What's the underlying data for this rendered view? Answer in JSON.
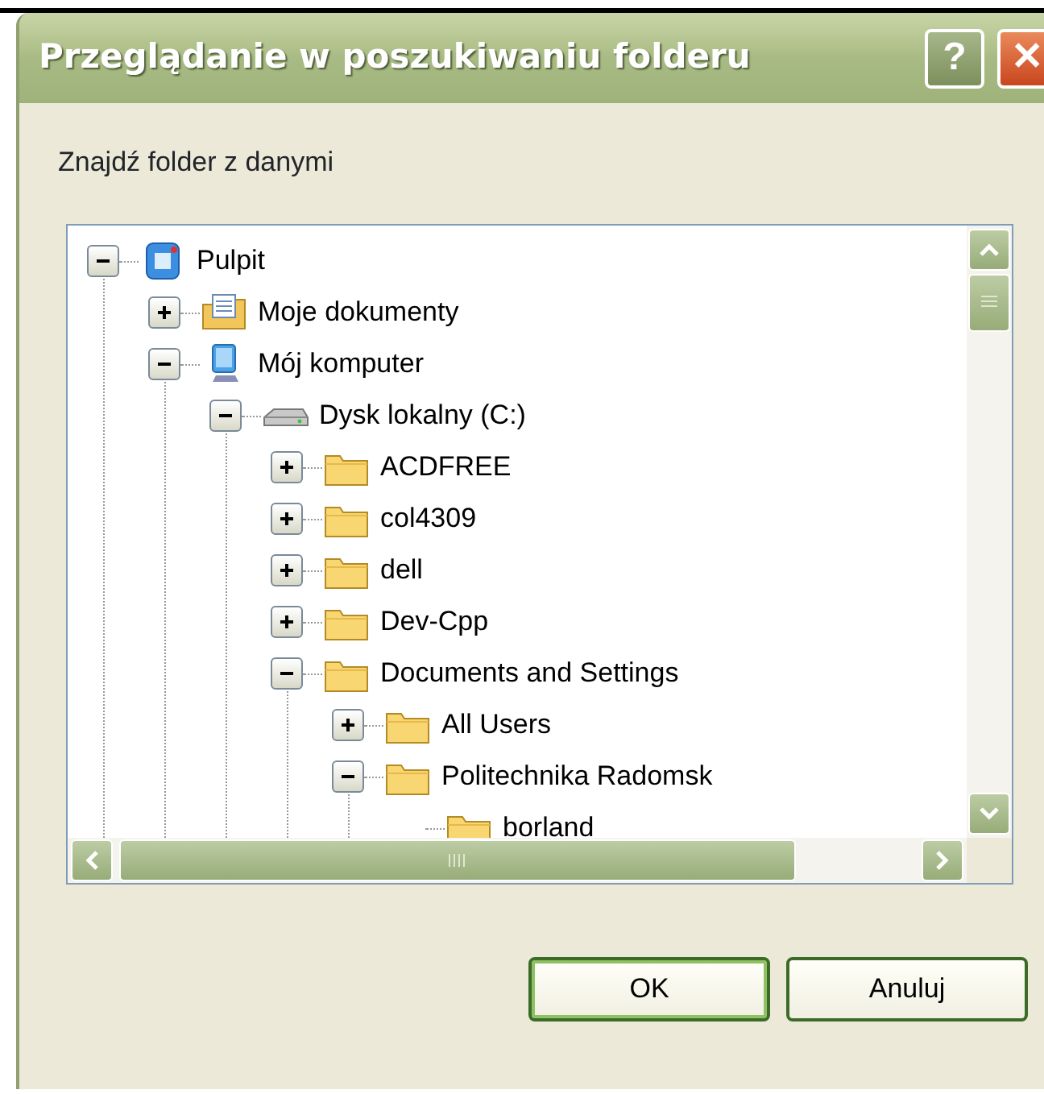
{
  "window": {
    "title": "Przeglądanie w poszukiwaniu folderu",
    "help_button": "?",
    "close_button": "✕"
  },
  "prompt": "Znajdź folder z danymi",
  "tree": [
    {
      "label": "Pulpit",
      "kind": "desktop",
      "expanded": true,
      "children": [
        {
          "label": "Moje dokumenty",
          "kind": "documents",
          "expanded": false
        },
        {
          "label": "Mój komputer",
          "kind": "computer",
          "expanded": true,
          "children": [
            {
              "label": "Dysk lokalny (C:)",
              "kind": "drive",
              "expanded": true,
              "children": [
                {
                  "label": "ACDFREE",
                  "kind": "folder",
                  "expanded": false
                },
                {
                  "label": "col4309",
                  "kind": "folder",
                  "expanded": false
                },
                {
                  "label": "dell",
                  "kind": "folder",
                  "expanded": false
                },
                {
                  "label": "Dev-Cpp",
                  "kind": "folder",
                  "expanded": false
                },
                {
                  "label": "Documents and Settings",
                  "kind": "folder",
                  "expanded": true,
                  "children": [
                    {
                      "label": "All Users",
                      "kind": "folder",
                      "expanded": false
                    },
                    {
                      "label": "Politechnika Radomsk",
                      "kind": "folder",
                      "expanded": true,
                      "children": [
                        {
                          "label": "borland",
                          "kind": "folder"
                        }
                      ]
                    }
                  ]
                }
              ]
            }
          ]
        }
      ]
    }
  ],
  "buttons": [
    {
      "label": "OK",
      "default": true
    },
    {
      "label": "Anuluj",
      "default": false
    }
  ]
}
